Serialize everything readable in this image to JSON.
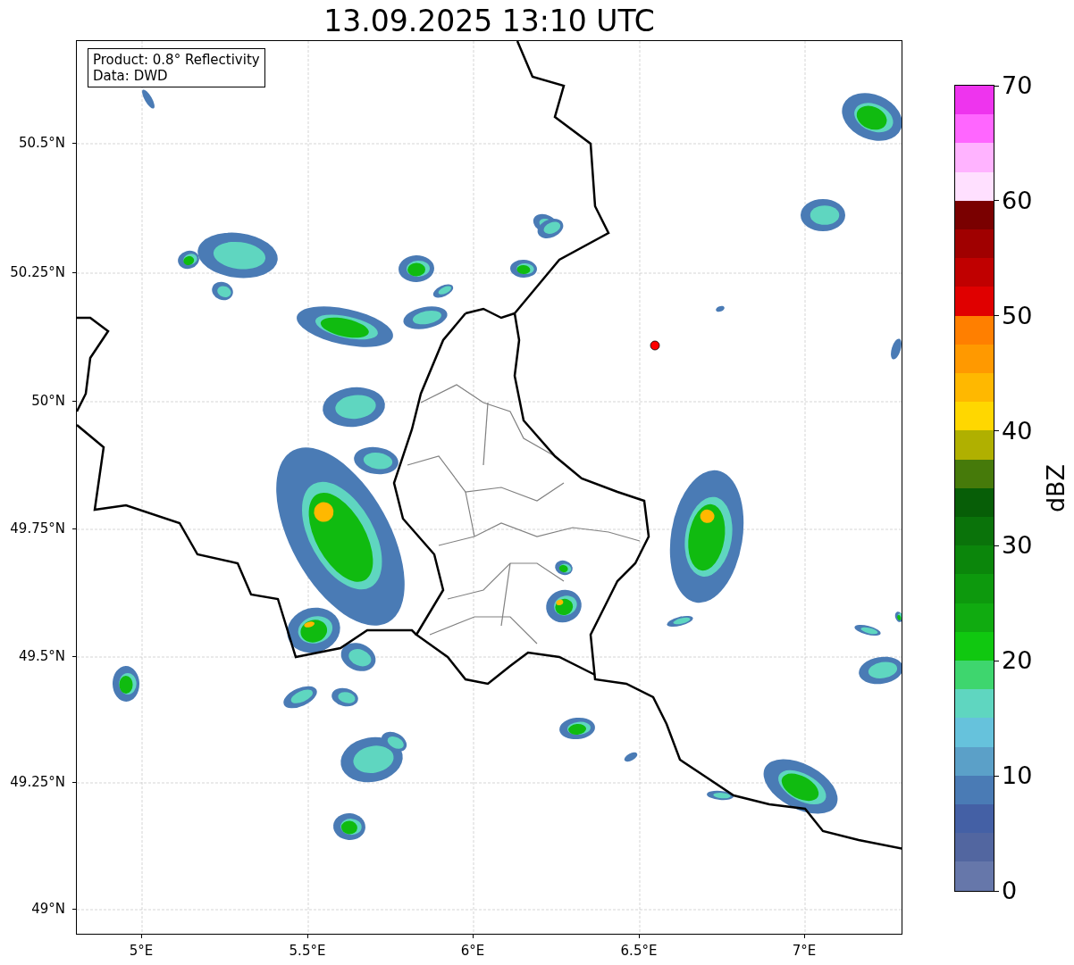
{
  "title": "13.09.2025 13:10 UTC",
  "legend": [
    "Product: 0.8° Reflectivity",
    "Data: DWD"
  ],
  "lat_labels": [
    "50.5°N",
    "50.25°N",
    "50°N",
    "49.75°N",
    "49.5°N",
    "49.25°N",
    "49°N"
  ],
  "lon_labels": [
    "5°E",
    "5.5°E",
    "6°E",
    "6.5°E",
    "7°E"
  ],
  "colorbar": {
    "label": "dBZ",
    "ticks": [
      "70",
      "60",
      "50",
      "40",
      "30",
      "20",
      "10",
      "0"
    ],
    "bins": [
      {
        "color": "#ee34ee"
      },
      {
        "color": "#ff66ff"
      },
      {
        "color": "#ffb3ff"
      },
      {
        "color": "#ffe0ff"
      },
      {
        "color": "#7a0000"
      },
      {
        "color": "#a00000"
      },
      {
        "color": "#c00000"
      },
      {
        "color": "#e00000"
      },
      {
        "color": "#ff7f00"
      },
      {
        "color": "#ff9900"
      },
      {
        "color": "#ffb800"
      },
      {
        "color": "#ffd700"
      },
      {
        "color": "#b0b000"
      },
      {
        "color": "#467a0a"
      },
      {
        "color": "#075e07"
      },
      {
        "color": "#0a730a"
      },
      {
        "color": "#0b860b"
      },
      {
        "color": "#0d990d"
      },
      {
        "color": "#10ab10"
      },
      {
        "color": "#10c810"
      },
      {
        "color": "#3ed66e"
      },
      {
        "color": "#5fd6c0"
      },
      {
        "color": "#66c2dc"
      },
      {
        "color": "#5ba0c8"
      },
      {
        "color": "#4a7bb5"
      },
      {
        "color": "#4460a5"
      },
      {
        "color": "#5266a0"
      },
      {
        "color": "#6677aa"
      }
    ]
  }
}
